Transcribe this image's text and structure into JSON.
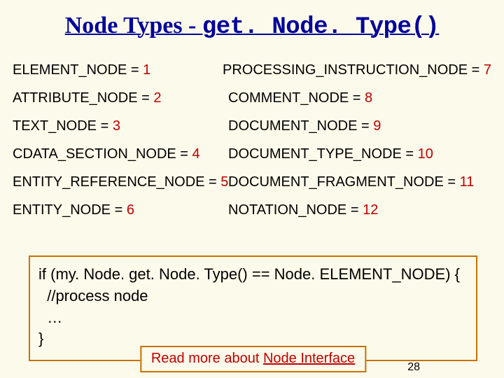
{
  "title": {
    "prefix": "Node Types - ",
    "mono": "get. Node. Type()"
  },
  "rows": [
    {
      "left_name": "ELEMENT_NODE",
      "left_val": "1",
      "right_name": "PROCESSING_INSTRUCTION_NODE",
      "right_val": "7"
    },
    {
      "left_name": "ATTRIBUTE_NODE",
      "left_val": "2",
      "right_name": "COMMENT_NODE",
      "right_val": "8"
    },
    {
      "left_name": "TEXT_NODE",
      "left_val": "3",
      "right_name": "DOCUMENT_NODE",
      "right_val": "9"
    },
    {
      "left_name": "CDATA_SECTION_NODE",
      "left_val": "4",
      "right_name": "DOCUMENT_TYPE_NODE",
      "right_val": "10"
    },
    {
      "left_name": "ENTITY_REFERENCE_NODE",
      "left_val": "5",
      "right_name": "DOCUMENT_FRAGMENT_NODE",
      "right_val": "11"
    },
    {
      "left_name": "ENTITY_NODE",
      "left_val": "6",
      "right_name": "NOTATION_NODE ",
      "right_val": "12"
    }
  ],
  "code": {
    "l1": "if (my. Node. get. Node. Type() == Node. ELEMENT_NODE) {",
    "l2": "  //process node",
    "l3": "  …",
    "l4": "}"
  },
  "readmore": {
    "pre": "Read more about ",
    "link": "Node Interface"
  },
  "pagenum": "28",
  "eq": " = "
}
